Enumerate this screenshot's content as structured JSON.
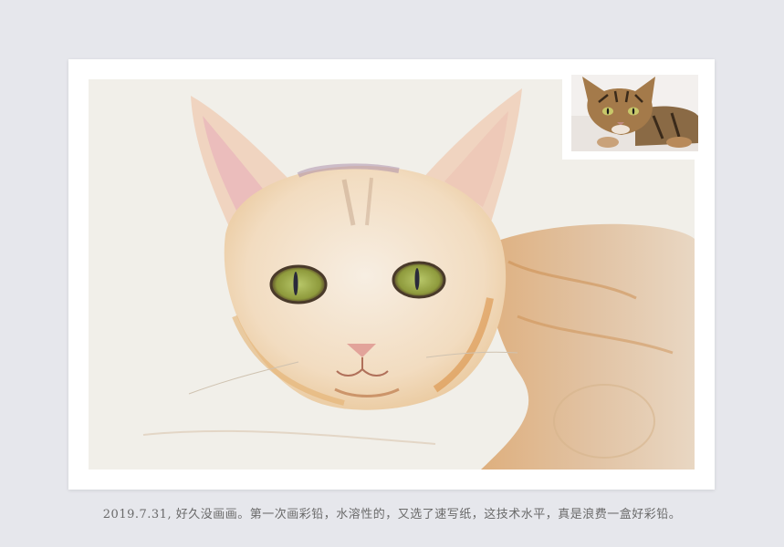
{
  "caption": "2019.7.31, 好久没画画。第一次画彩铅，水溶性的，又选了速写纸，这技术水平，真是浪费一盒好彩铅。",
  "colors": {
    "background": "#e6e7ec",
    "frame": "#ffffff",
    "paper": "#f1efe9",
    "caption_text": "#6a6a6a"
  }
}
